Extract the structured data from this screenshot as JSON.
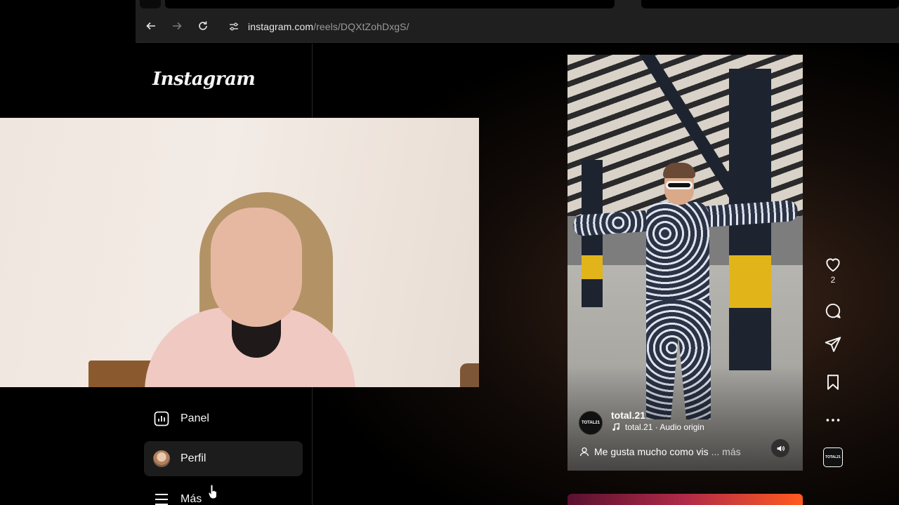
{
  "browser": {
    "url_host": "instagram.com",
    "url_path": "/reels/DQXtZohDxgS/"
  },
  "sidebar": {
    "logo": "Instagram",
    "items": [
      {
        "label": "Panel",
        "icon": "dashboard-icon"
      },
      {
        "label": "Perfil",
        "icon": "avatar"
      },
      {
        "label": "Más",
        "icon": "menu-icon"
      }
    ]
  },
  "reel": {
    "account_name": "total.21",
    "account_avatar_text": "TOTAL21",
    "audio": "total.21 · Audio origin",
    "caption": "Me gusta mucho como vis",
    "caption_more": "... más"
  },
  "actions": {
    "like_count": "2",
    "audio_thumb_text": "TOTAL21"
  },
  "colors": {
    "background": "#000000",
    "chrome": "#1f1f1f",
    "text": "#f5f5f5",
    "muted": "#9a9a9a"
  }
}
